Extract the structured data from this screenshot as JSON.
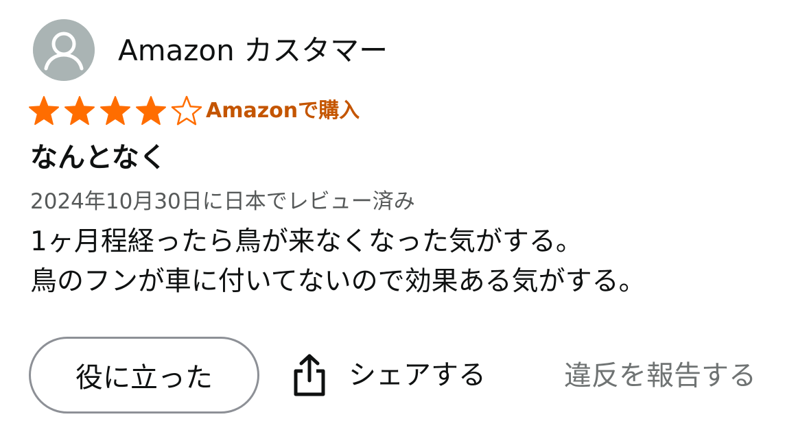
{
  "reviewer": {
    "name": "Amazon カスタマー",
    "avatar_icon": "default-user-avatar-icon",
    "avatar_color": "#aab4b4"
  },
  "rating": {
    "value": 4,
    "max": 5,
    "filled_color": "#ff6d00",
    "empty_color": "#ff6d00",
    "star_icon": "star-icon"
  },
  "verified": {
    "label": "Amazonで購入",
    "color": "#c45500"
  },
  "review": {
    "title": "なんとなく",
    "date_line": "2024年10月30日に日本でレビュー済み",
    "body_lines": [
      "1ヶ月程経ったら鳥が来なくなった気がする。",
      "鳥のフンが車に付いてないので効果ある気がする。"
    ]
  },
  "actions": {
    "helpful_label": "役に立った",
    "share_label": "シェアする",
    "share_icon": "share-icon",
    "report_label": "違反を報告する"
  }
}
